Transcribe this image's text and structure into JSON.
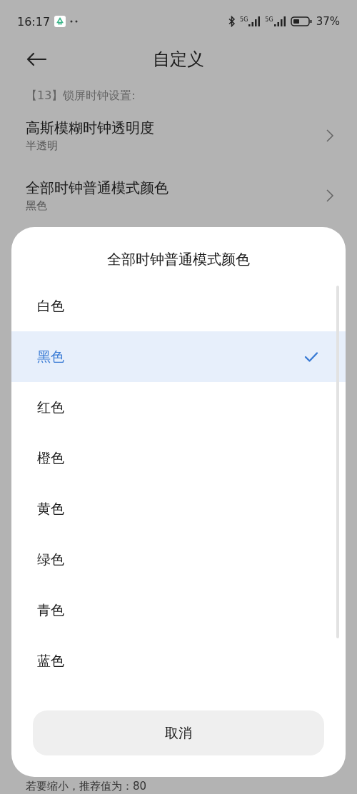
{
  "status_bar": {
    "time": "16:17",
    "network_1": "5G",
    "network_2": "5G",
    "battery": "37%"
  },
  "header": {
    "title": "自定义"
  },
  "section_label": "【13】锁屏时钟设置:",
  "settings": [
    {
      "title": "高斯模糊时钟透明度",
      "value": "半透明"
    },
    {
      "title": "全部时钟普通模式颜色",
      "value": "黑色"
    }
  ],
  "footer_hint": "若要缩小，推荐值为：80",
  "dialog": {
    "title": "全部时钟普通模式颜色",
    "options": [
      {
        "label": "白色",
        "selected": false
      },
      {
        "label": "黑色",
        "selected": true
      },
      {
        "label": "红色",
        "selected": false
      },
      {
        "label": "橙色",
        "selected": false
      },
      {
        "label": "黄色",
        "selected": false
      },
      {
        "label": "绿色",
        "selected": false
      },
      {
        "label": "青色",
        "selected": false
      },
      {
        "label": "蓝色",
        "selected": false
      }
    ],
    "cancel": "取消"
  }
}
